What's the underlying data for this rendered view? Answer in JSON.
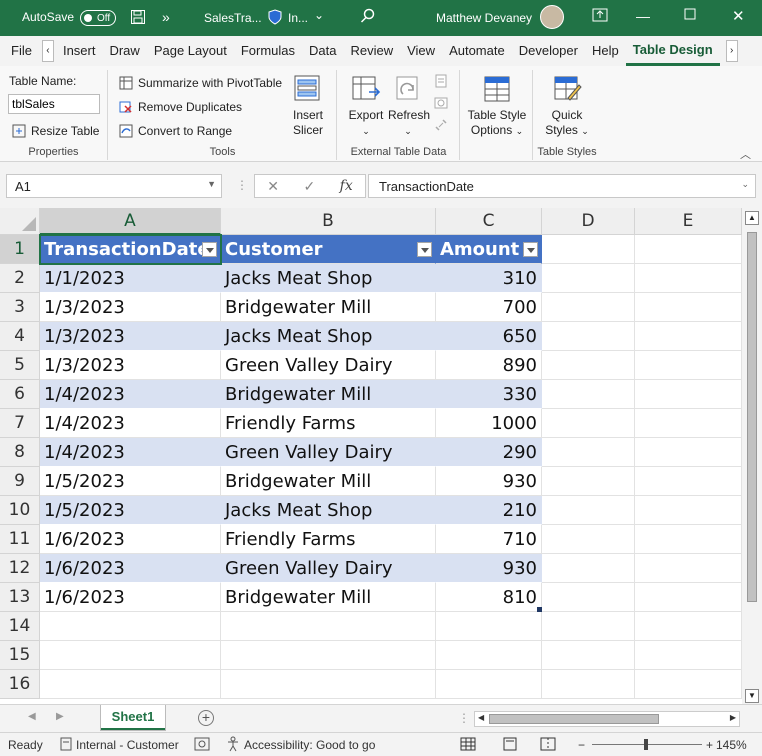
{
  "titlebar": {
    "autosave_label": "AutoSave",
    "autosave_state": "Off",
    "overflow_glyph": "»",
    "filename": "SalesTra...",
    "sensitivity": "In...",
    "user_name": "Matthew Devaney",
    "accent": "#217346"
  },
  "ribbon_tabs": [
    "File",
    "Insert",
    "Draw",
    "Page Layout",
    "Formulas",
    "Data",
    "Review",
    "View",
    "Automate",
    "Developer",
    "Help",
    "Table Design"
  ],
  "active_tab": "Table Design",
  "ribbon": {
    "properties": {
      "table_name_label": "Table Name:",
      "table_name_value": "tblSales",
      "resize_table": "Resize Table",
      "group_label": "Properties"
    },
    "tools": {
      "summarize": "Summarize with PivotTable",
      "remove_duplicates": "Remove Duplicates",
      "convert_to_range": "Convert to Range",
      "insert_slicer_1": "Insert",
      "insert_slicer_2": "Slicer",
      "group_label": "Tools"
    },
    "external": {
      "export": "Export",
      "refresh": "Refresh",
      "group_label": "External Table Data"
    },
    "style_options": {
      "label_1": "Table Style",
      "label_2": "Options"
    },
    "styles": {
      "quick_1": "Quick",
      "quick_2": "Styles",
      "group_label": "Table Styles"
    }
  },
  "formula_bar": {
    "name_box": "A1",
    "cancel": "✕",
    "enter": "✓",
    "fx": "fx",
    "formula": "TransactionDate"
  },
  "grid": {
    "columns": [
      "A",
      "B",
      "C",
      "D",
      "E"
    ],
    "row_numbers": [
      "1",
      "2",
      "3",
      "4",
      "5",
      "6",
      "7",
      "8",
      "9",
      "10",
      "11",
      "12",
      "13",
      "14",
      "15",
      "16"
    ],
    "table_headers": [
      "TransactionDate",
      "Customer",
      "Amount"
    ],
    "rows": [
      [
        "1/1/2023",
        "Jacks Meat Shop",
        "310"
      ],
      [
        "1/3/2023",
        "Bridgewater Mill",
        "700"
      ],
      [
        "1/3/2023",
        "Jacks Meat Shop",
        "650"
      ],
      [
        "1/3/2023",
        "Green Valley Dairy",
        "890"
      ],
      [
        "1/4/2023",
        "Bridgewater Mill",
        "330"
      ],
      [
        "1/4/2023",
        "Friendly Farms",
        "1000"
      ],
      [
        "1/4/2023",
        "Green Valley Dairy",
        "290"
      ],
      [
        "1/5/2023",
        "Bridgewater Mill",
        "930"
      ],
      [
        "1/5/2023",
        "Jacks Meat Shop",
        "210"
      ],
      [
        "1/6/2023",
        "Friendly Farms",
        "710"
      ],
      [
        "1/6/2023",
        "Green Valley Dairy",
        "930"
      ],
      [
        "1/6/2023",
        "Bridgewater Mill",
        "810"
      ]
    ],
    "header_color": "#4472c4",
    "band_color": "#d9e1f2"
  },
  "sheets": {
    "active": "Sheet1",
    "add": "+"
  },
  "status": {
    "mode": "Ready",
    "sensitivity": "Internal - Customer",
    "accessibility": "Accessibility: Good to go",
    "zoom_minus": "−",
    "zoom_plus": "+",
    "zoom": "145%"
  }
}
